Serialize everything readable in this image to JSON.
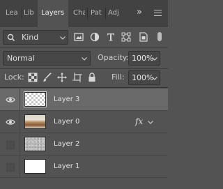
{
  "tabs": [
    {
      "label": "Lea",
      "active": false
    },
    {
      "label": "Lib",
      "active": false
    },
    {
      "label": "Layers",
      "active": true
    },
    {
      "label": "Cha",
      "active": false
    },
    {
      "label": "Pat",
      "active": false
    },
    {
      "label": "Adj",
      "active": false
    }
  ],
  "tabs_overflow_icon": "double-chevron-right-icon",
  "panel_menu_icon": "hamburger-menu-icon",
  "filter": {
    "kind_label": "Kind",
    "icons": [
      "image-filter-icon",
      "adjustment-filter-icon",
      "type-filter-icon",
      "shape-filter-icon",
      "smart-object-filter-icon"
    ]
  },
  "blend": {
    "mode": "Normal",
    "opacity_label": "Opacity:",
    "opacity_value": "100%",
    "fill_label": "Fill:",
    "fill_value": "100%"
  },
  "lock": {
    "label": "Lock:",
    "icons": [
      "lock-transparent-pixels-icon",
      "lock-image-pixels-icon",
      "lock-position-icon",
      "lock-artboard-icon",
      "lock-all-icon"
    ]
  },
  "layers": [
    {
      "name": "Layer 3",
      "visible": true,
      "selected": true,
      "thumbnail": "transparent",
      "fx": false
    },
    {
      "name": "Layer 0",
      "visible": true,
      "selected": false,
      "thumbnail": "photo",
      "fx": true,
      "fx_label": "fx"
    },
    {
      "name": "Layer 2",
      "visible": false,
      "selected": false,
      "thumbnail": "noise",
      "fx": false
    },
    {
      "name": "Layer 1",
      "visible": false,
      "selected": false,
      "thumbnail": "white",
      "fx": false
    }
  ],
  "colors": {
    "panel_bg": "#535353",
    "tabbar_bg": "#424242",
    "selected_row": "#696969"
  }
}
